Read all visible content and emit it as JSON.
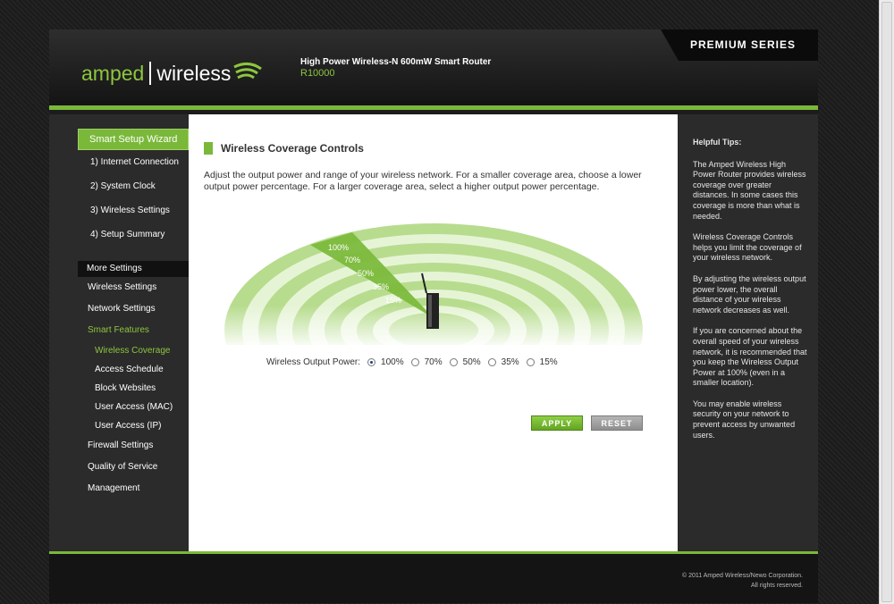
{
  "header": {
    "logo_part1": "amped",
    "logo_part2": "wireless",
    "product_name": "High Power Wireless-N 600mW Smart Router",
    "model": "R10000",
    "series_badge": "PREMIUM SERIES",
    "accent_color": "#7ab83a"
  },
  "sidebar": {
    "wizard_title": "Smart Setup Wizard",
    "wizard_items": [
      {
        "label": "1) Internet Connection"
      },
      {
        "label": "2) System Clock"
      },
      {
        "label": "3) Wireless Settings"
      },
      {
        "label": "4) Setup Summary"
      }
    ],
    "more_title": "More Settings",
    "wireless_settings": "Wireless Settings",
    "network_settings": "Network Settings",
    "smart_features": "Smart Features",
    "smart_sub": [
      {
        "label": "Wireless Coverage"
      },
      {
        "label": "Access Schedule"
      },
      {
        "label": "Block Websites"
      },
      {
        "label": "User Access (MAC)"
      },
      {
        "label": "User Access (IP)"
      }
    ],
    "firewall_settings": "Firewall Settings",
    "qos": "Quality of Service",
    "management": "Management"
  },
  "main": {
    "title": "Wireless Coverage Controls",
    "description": "Adjust the output power and range of your wireless network. For a smaller coverage area, choose a lower output power percentage. For a larger coverage area, select a higher output power percentage.",
    "graphic_labels": [
      "100%",
      "70%",
      "50%",
      "35%",
      "15%"
    ],
    "power_label": "Wireless Output Power:",
    "power_options": [
      {
        "label": "100%",
        "selected": true
      },
      {
        "label": "70%",
        "selected": false
      },
      {
        "label": "50%",
        "selected": false
      },
      {
        "label": "35%",
        "selected": false
      },
      {
        "label": "15%",
        "selected": false
      }
    ],
    "apply_label": "APPLY",
    "reset_label": "RESET"
  },
  "tips": {
    "title": "Helpful Tips:",
    "paragraphs": [
      "The Amped Wireless High Power Router provides wireless coverage over greater distances.  In some cases this coverage is more than what is needed.",
      "Wireless Coverage Controls helps you limit the coverage of your wireless network.",
      "By adjusting the wireless output power lower, the overall distance of your wireless network decreases as well.",
      "If you are concerned about the overall speed of your wireless network, it is recommended that you keep the Wireless Output Power at 100% (even in a smaller location).",
      "You may enable wireless security on your network to prevent access by unwanted users."
    ]
  },
  "footer": {
    "copyright": "© 2011 Amped Wireless/Newo Corporation.",
    "rights": "All rights reserved."
  }
}
